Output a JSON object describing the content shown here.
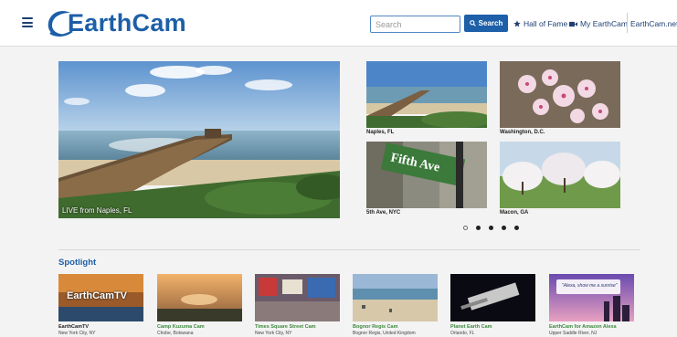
{
  "header": {
    "logo_text": "EarthCam",
    "search_placeholder": "Search",
    "search_button": "Search",
    "nav": {
      "hall_of_fame": "Hall of Fame",
      "my_earthcam": "My EarthCam",
      "earthcam_net": "EarthCam.net"
    }
  },
  "hero": {
    "caption": "LIVE from Naples, FL"
  },
  "featured": [
    {
      "label": "Naples, FL"
    },
    {
      "label": "Washington, D.C."
    },
    {
      "label": "5th Ave, NYC"
    },
    {
      "label": "Macon, GA"
    }
  ],
  "street_sign": "Fifth Ave",
  "carousel": {
    "dots": 5,
    "active": 0
  },
  "spotlight": {
    "title": "Spotlight",
    "items": [
      {
        "name": "EarthCamTV",
        "location": "New York City, NY",
        "overlay": "EarthCamTV"
      },
      {
        "name": "Camp Kuzuma Cam",
        "location": "Chobe, Botswana"
      },
      {
        "name": "Times Square Street Cam",
        "location": "New York City, NY"
      },
      {
        "name": "Bognor Regis Cam",
        "location": "Bognor Regis, United Kingdom"
      },
      {
        "name": "Planet Earth Cam",
        "location": "Orlando, FL"
      },
      {
        "name": "EarthCam for Amazon Alexa",
        "location": "Upper Saddle River, NJ",
        "overlay": "\"Alexa, show me a sunrise\""
      }
    ]
  },
  "colors": {
    "brand_blue": "#1d5fa8",
    "nav_dark": "#1d3f72",
    "spotlight_green": "#3c8a3c"
  }
}
